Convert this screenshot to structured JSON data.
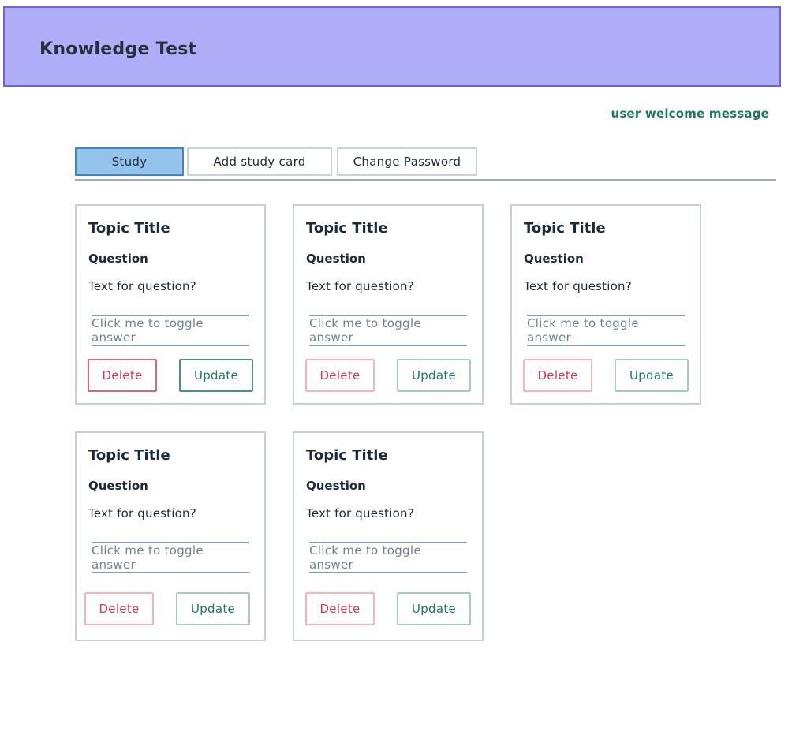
{
  "app": {
    "title": "Knowledge Test",
    "welcome_message": "user welcome message"
  },
  "tabs": [
    {
      "label": "Study",
      "active": true
    },
    {
      "label": "Add study card",
      "active": false
    },
    {
      "label": "Change Password",
      "active": false
    }
  ],
  "cards": [
    {
      "topic": "Topic Title",
      "question_label": "Question",
      "question_text": "Text for question?",
      "toggle_label": "Click me to toggle answer",
      "delete_label": "Delete",
      "update_label": "Update"
    },
    {
      "topic": "Topic Title",
      "question_label": "Question",
      "question_text": "Text for question?",
      "toggle_label": "Click me to toggle answer",
      "delete_label": "Delete",
      "update_label": "Update"
    },
    {
      "topic": "Topic Title",
      "question_label": "Question",
      "question_text": "Text for question?",
      "toggle_label": "Click me to toggle answer",
      "delete_label": "Delete",
      "update_label": "Update"
    },
    {
      "topic": "Topic Title",
      "question_label": "Question",
      "question_text": "Text for question?",
      "toggle_label": "Click me to toggle answer",
      "delete_label": "Delete",
      "update_label": "Update"
    },
    {
      "topic": "Topic Title",
      "question_label": "Question",
      "question_text": "Text for question?",
      "toggle_label": "Click me to toggle answer",
      "delete_label": "Delete",
      "update_label": "Update"
    }
  ],
  "colors": {
    "header_bg": "#b1aef9",
    "header_border": "#6e65d9",
    "active_tab_bg": "#94c3ec",
    "welcome_text": "#1e7a5e",
    "delete_text": "#d03a52",
    "update_text": "#1e7a5e"
  }
}
